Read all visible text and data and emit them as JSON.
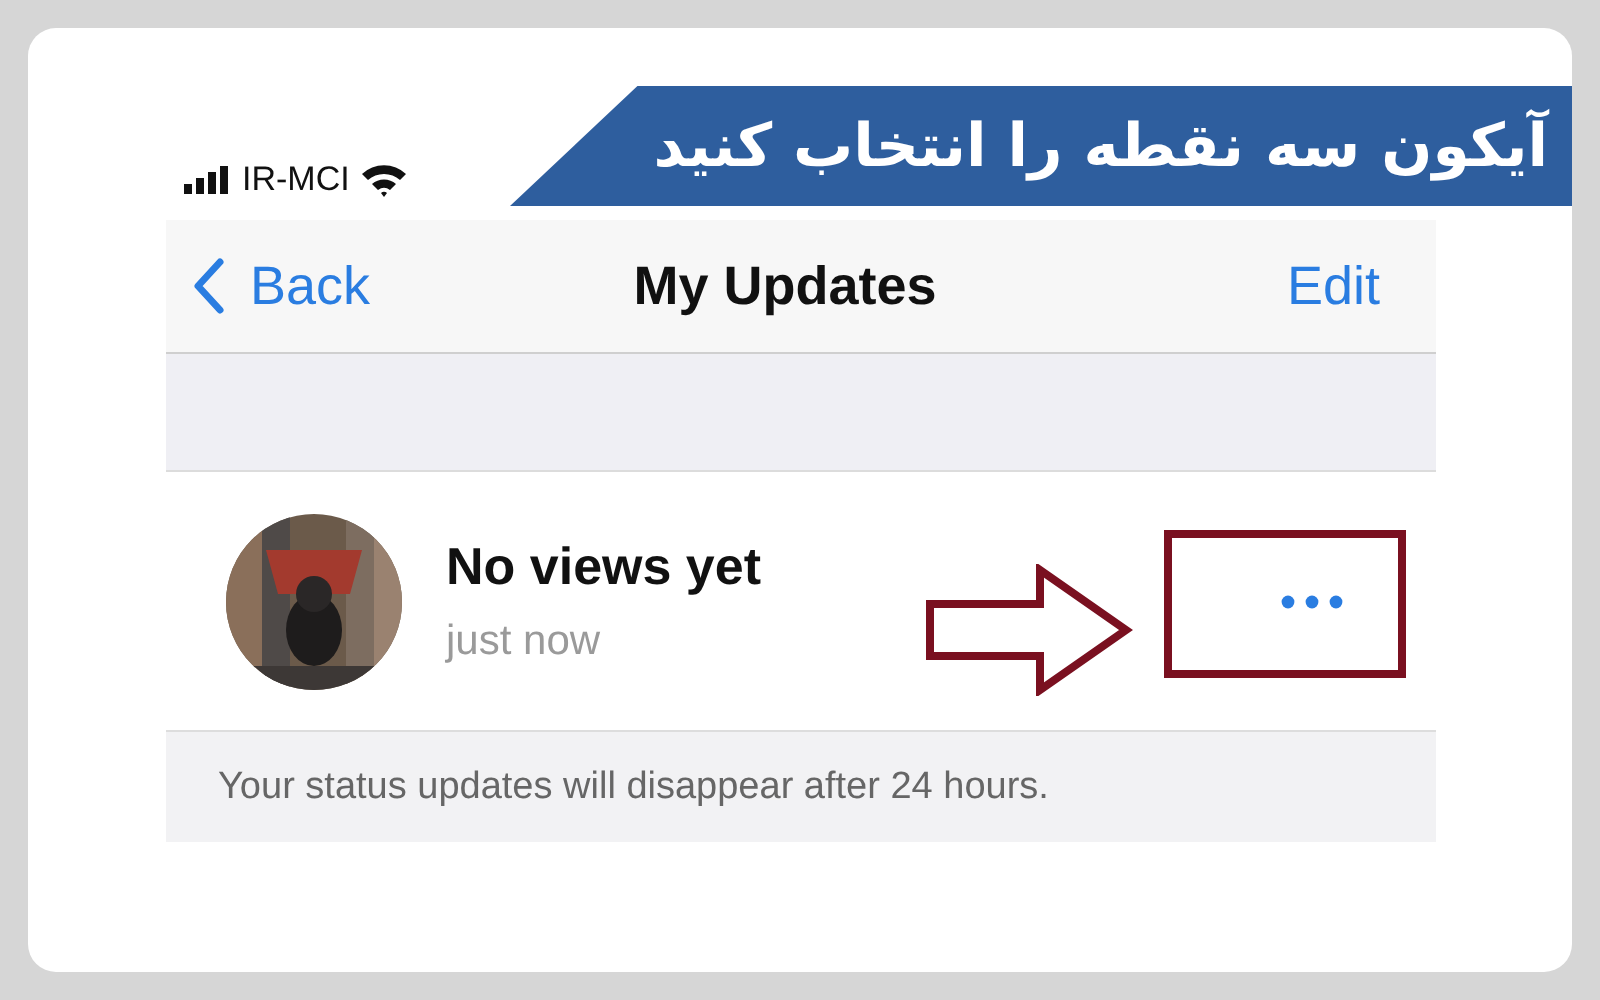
{
  "banner": {
    "text": "آیکون سه نقطه را انتخاب کنید"
  },
  "status_bar": {
    "carrier": "IR-MCI"
  },
  "nav": {
    "back": "Back",
    "title": "My Updates",
    "edit": "Edit"
  },
  "update": {
    "title": "No views yet",
    "time": "just now"
  },
  "footer": "Your status updates will disappear after 24 hours."
}
